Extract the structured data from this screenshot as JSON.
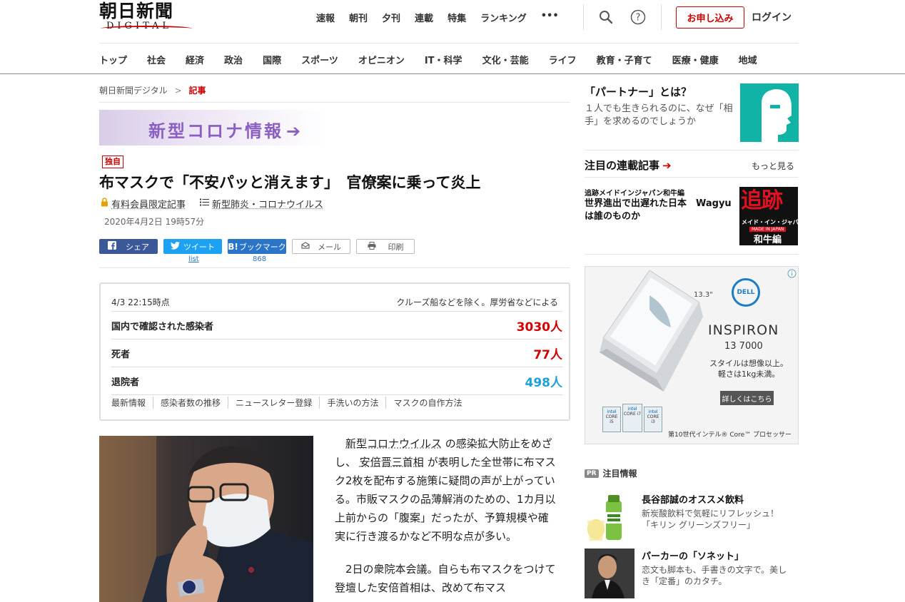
{
  "header": {
    "logo_jp": "朝日新聞",
    "logo_en": "DIGITAL",
    "topnav": [
      "速報",
      "朝刊",
      "夕刊",
      "連載",
      "特集",
      "ランキング",
      "•••"
    ],
    "subscribe": "お申し込み",
    "login": "ログイン"
  },
  "categories": [
    "トップ",
    "社会",
    "経済",
    "政治",
    "国際",
    "スポーツ",
    "オピニオン",
    "IT・科学",
    "文化・芸能",
    "ライフ",
    "教育・子育て",
    "医療・健康",
    "地域"
  ],
  "breadcrumb": {
    "home": "朝日新聞デジタル",
    "sep": ">",
    "current": "記事"
  },
  "banner": {
    "text": "新型コロナ情報"
  },
  "article": {
    "tag": "独自",
    "title": "布マスクで「不安パッと消えます」　官僚案に乗って炎上",
    "members_only": "有料会員限定記事",
    "topic": "新型肺炎・コロナウイルス",
    "date": "2020年4月2日 19時57分"
  },
  "share": {
    "facebook": "シェア",
    "twitter": "ツイート",
    "twitter_count": "list",
    "hatena": "ブックマーク",
    "hatena_count": "868",
    "mail": "メール",
    "print": "印刷"
  },
  "covid": {
    "timestamp": "4/3 22:15時点",
    "source": "クルーズ船などを除く。厚労省などによる",
    "rows": [
      {
        "label": "国内で確認された感染者",
        "value": "3030人",
        "color": "#d40000"
      },
      {
        "label": "死者",
        "value": "77人",
        "color": "#d40000"
      },
      {
        "label": "退院者",
        "value": "498人",
        "color": "#1ea0d8"
      }
    ],
    "links": [
      "最新情報",
      "感染者数の推移",
      "ニュースレター登録",
      "手洗いの方法",
      "マスクの自作方法"
    ]
  },
  "body": {
    "p1_a": "新型コロナウイルス",
    "p1_b": "の感染拡大防止をめざし、",
    "p1_c": "安倍晋三首相",
    "p1_d": "が表明した全世帯に布マスク2枚を配布する施策に疑問の声が上がっている。市販マスクの品薄解消のための、1カ月以上前からの「腹案」だったが、予算規模や確実に行き渡るかなど不明な点が多い。",
    "p2": "2日の衆院本会議。自らも布マスクをつけて登壇した安倍首相は、改めて布マス"
  },
  "sidebar": {
    "partner_title": "「パートナー」とは？",
    "partner_desc": "１人でも生きられるのに、なぜ「相手」を求めるのでしょうか",
    "series_heading": "注目の連載記事",
    "more": "もっと見る",
    "series_kicker": "追跡メイドインジャパン和牛編",
    "series_title": "世界進出で出遅れた日本　Wagyuは誰のものか",
    "series_img_big": "追跡",
    "series_img_sub": "メイド・イン・ジャパン",
    "series_img_tag": "MADE IN JAPAN",
    "series_img_foot": "和牛編",
    "ad": {
      "size": "13.3\"",
      "brand": "DELL",
      "model": "INSPIRON",
      "model_no": "13 7000",
      "copy1": "スタイルは想像以上。",
      "copy2": "軽さは1kg未満。",
      "cta": "詳しくはこちら",
      "cpu_note": "第10世代インテル® Core™ プロセッサー",
      "chip_brand": "intel",
      "chip_labels": [
        "CORE i5",
        "CORE i7",
        "CORE i3"
      ]
    },
    "pr_badge": "PR",
    "pr_heading": "注目情報",
    "pr_items": [
      {
        "title": "長谷部誠のオススメ飲料",
        "desc": "新炭酸飲料で気軽にリフレッシュ！「キリン グリーンズフリー」"
      },
      {
        "title": "パーカーの「ソネット」",
        "desc": "恋文も脚本も、手書きの文字で。美しき「定番」のカタチ。"
      }
    ]
  }
}
